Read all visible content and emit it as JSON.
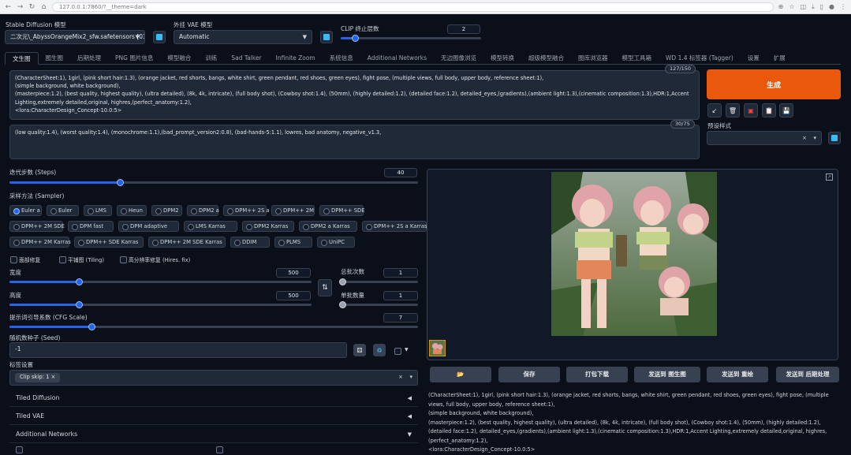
{
  "browser": {
    "url": "127.0.0.1:7860/?__theme=dark"
  },
  "top": {
    "sd_model_label": "Stable Diffusion 模型",
    "sd_model_value": "二次元\\_AbyssOrangeMix2_sfw.safetensors [03",
    "vae_label": "外挂 VAE 模型",
    "vae_value": "Automatic",
    "clip_label": "CLIP 终止层数",
    "clip_value": "2",
    "clip_fraction": 0.1
  },
  "tabs": [
    "文生图",
    "图生图",
    "后期处理",
    "PNG 图片信息",
    "模型融合",
    "训练",
    "Sad Talker",
    "Infinite Zoom",
    "系统信息",
    "Additional Networks",
    "无边图像浏览",
    "模型转换",
    "超级模型融合",
    "图库浏览器",
    "模型工具箱",
    "WD 1.4 标签器 (Tagger)",
    "设置",
    "扩展"
  ],
  "prompt": {
    "text": "(CharacterSheet:1), 1girl, (pink short hair:1.3), (orange jacket, red shorts, bangs, white shirt, green pendant, red shoes, green eyes), fight pose, (multiple views, full body, upper body, reference sheet:1),\n(simple background, white background),\n(masterpiece:1.2), (best quality, highest quality), (ultra detailed), (8k, 4k, intricate), (full body shot), (Cowboy shot:1.4), (50mm), (highly detailed:1.2), (detailed face:1.2), detailed_eyes,(gradients),(ambient light:1.3),(cinematic composition:1.3),HDR:1,Accent Lighting,extremely detailed,original, highres,(perfect_anatomy:1.2),\n<lora:CharacterDesign_Concept-10.0:5>",
    "counter": "127/150",
    "negative_text": "(low quality:1.4), (worst quality:1.4), (monochrome:1.1),(bad_prompt_version2:0.8), (bad-hands-5:1.1), lowres, bad anatomy, negative_v1.3,",
    "negative_counter": "30/75"
  },
  "right_top": {
    "generate_label": "生成",
    "tools": [
      "↙",
      "🗑",
      "▣",
      "📋",
      "💾"
    ],
    "style_label": "预设样式",
    "style_clear": "×",
    "style_arrow": "▾"
  },
  "params": {
    "steps_label": "迭代步数 (Steps)",
    "steps_value": "40",
    "steps_fraction": 0.27,
    "sampler_label": "采样方法 (Sampler)",
    "samplers": [
      "Euler a",
      "Euler",
      "LMS",
      "Heun",
      "DPM2",
      "DPM2 a",
      "DPM++ 2S a",
      "DPM++ 2M",
      "DPM++ SDE",
      "DPM++ 2M SDE",
      "DPM fast",
      "DPM adaptive",
      "LMS Karras",
      "DPM2 Karras",
      "DPM2 a Karras",
      "DPM++ 2S a Karras",
      "DPM++ 2M Karras",
      "DPM++ SDE Karras",
      "DPM++ 2M SDE Karras",
      "DDIM",
      "PLMS",
      "UniPC"
    ],
    "selected_sampler": "Euler a",
    "checks": [
      "面部修复",
      "平铺图 (Tiling)",
      "高分辨率修复 (Hires. fix)"
    ],
    "width_label": "宽度",
    "width_value": "500",
    "width_fraction": 0.23,
    "height_label": "高度",
    "height_value": "500",
    "height_fraction": 0.23,
    "batch_count_label": "总批次数",
    "batch_count_value": "1",
    "batch_size_label": "单批数量",
    "batch_size_value": "1",
    "cfg_label": "提示词引导系数 (CFG Scale)",
    "cfg_value": "7",
    "cfg_fraction": 0.2,
    "seed_label": "随机数种子 (Seed)",
    "seed_value": "-1",
    "swap_icon": "⇅",
    "script_label": "标签设置",
    "script_chip": "Clip skip: 1",
    "script_chip_x": "×"
  },
  "accordions": [
    {
      "label": "Tiled Diffusion",
      "icon": "◀"
    },
    {
      "label": "Tiled VAE",
      "icon": "◀"
    },
    {
      "label": "Additional Networks",
      "icon": "▼"
    }
  ],
  "output": {
    "actions": [
      "📂",
      "保存",
      "打包下载",
      "发送到 图生图",
      "发送到 重绘",
      "发送到 后期处理"
    ],
    "info": "(CharacterSheet:1), 1girl, (pink short hair:1.3), (orange jacket, red shorts, bangs, white shirt, green pendant, red shoes, green eyes), fight pose, (multiple views, full body, upper body, reference sheet:1),\n(simple background, white background),\n(masterpiece:1.2), (best quality, highest quality), (ultra detailed), (8k, 4k, intricate), (full body shot), (Cowboy shot:1.4), (50mm), (highly detailed:1.2), (detailed face:1.2), detailed_eyes,(gradients),(ambient light:1.3),(cinematic composition:1.3),HDR:1,Accent Lighting,extremely detailed,original, highres,(perfect_anatomy:1.2),\n<lora:CharacterDesign_Concept-10.0:5>"
  }
}
